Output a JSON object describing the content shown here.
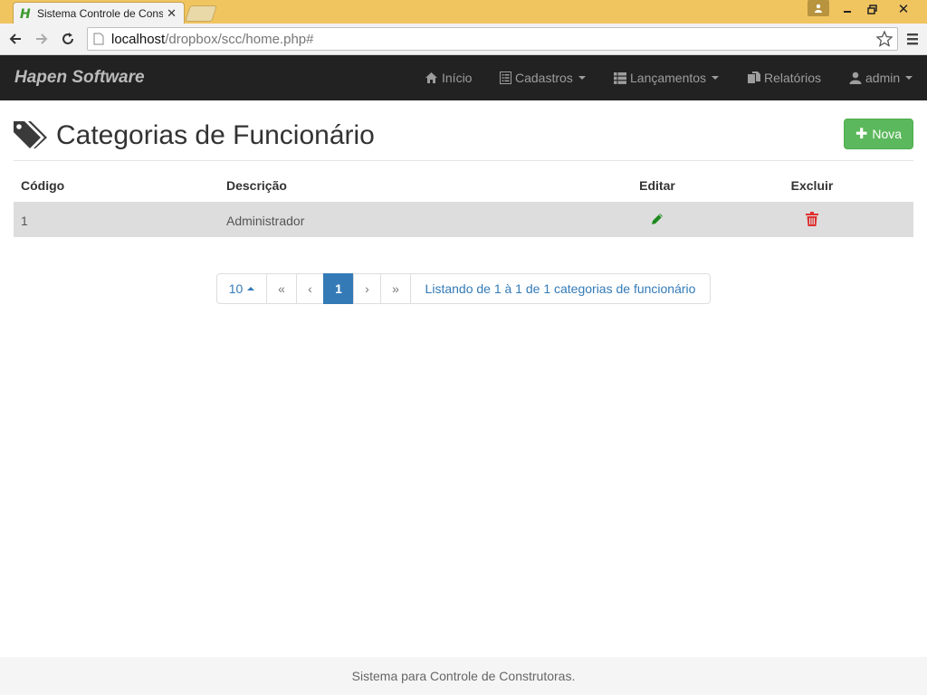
{
  "browser": {
    "tab_title": "Sistema Controle de Cons",
    "url_host": "localhost",
    "url_path": "/dropbox/scc/home.php#"
  },
  "navbar": {
    "brand": "Hapen Software",
    "items": [
      {
        "label": "Início",
        "icon": "home-icon"
      },
      {
        "label": "Cadastros",
        "icon": "list-alt-icon"
      },
      {
        "label": "Lançamentos",
        "icon": "th-list-icon"
      },
      {
        "label": "Relatórios",
        "icon": "duplicate-icon"
      },
      {
        "label": "admin",
        "icon": "user-icon"
      }
    ]
  },
  "page": {
    "title": "Categorias de Funcionário",
    "new_button": "Nova"
  },
  "table": {
    "headers": [
      "Código",
      "Descrição",
      "Editar",
      "Excluir"
    ],
    "rows": [
      {
        "code": "1",
        "description": "Administrador"
      }
    ]
  },
  "pagination": {
    "page_size": "10",
    "first": "«",
    "prev": "‹",
    "current": "1",
    "next": "›",
    "last": "»",
    "summary": "Listando de 1 à 1 de 1 categorias de funcionário"
  },
  "footer": {
    "text": "Sistema para Controle de Construtoras."
  },
  "colors": {
    "navbar_bg": "#222222",
    "success": "#5cb85c",
    "primary": "#337ab7",
    "edit_icon": "#1d8a1d",
    "delete_icon": "#e03030"
  }
}
